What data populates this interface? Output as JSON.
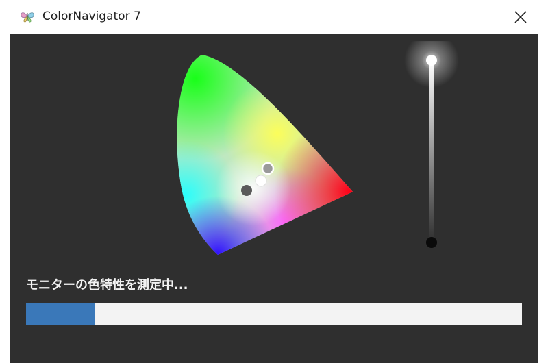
{
  "window": {
    "title": "ColorNavigator 7",
    "app_icon": "butterfly-icon",
    "close_icon": "close-icon"
  },
  "status": {
    "text": "モニターの色特性を測定中..."
  },
  "progress": {
    "value_percent": 14
  },
  "brightness_slider": {
    "level_percent": 100
  },
  "colors": {
    "background": "#2f2f2f",
    "titlebar": "#ffffff",
    "progress_fill": "#3a78b9",
    "progress_track": "#f3f3f3",
    "status_text": "#f2f2f2"
  }
}
